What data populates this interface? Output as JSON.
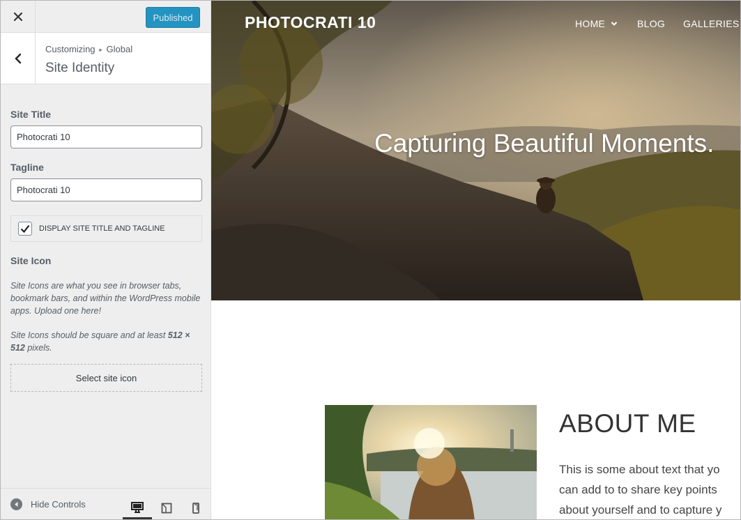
{
  "sidebar": {
    "publish_label": "Published",
    "breadcrumb_root": "Customizing",
    "breadcrumb_child": "Global",
    "section_title": "Site Identity",
    "site_title_label": "Site Title",
    "site_title_value": "Photocrati 10",
    "tagline_label": "Tagline",
    "tagline_value": "Photocrati 10",
    "display_checkbox_label": "Display Site Title and Tagline",
    "display_checkbox_checked": true,
    "site_icon_label": "Site Icon",
    "site_icon_desc": "Site Icons are what you see in browser tabs, bookmark bars, and within the WordPress mobile apps. Upload one here!",
    "site_icon_size_pre": "Site Icons should be square and at least ",
    "site_icon_size_value": "512 × 512",
    "site_icon_size_post": " pixels.",
    "select_icon_label": "Select site icon",
    "hide_controls_label": "Hide Controls"
  },
  "preview": {
    "site_title": "PHOTOCRATI 10",
    "nav": [
      "HOME",
      "BLOG",
      "GALLERIES"
    ],
    "hero_text": "Capturing Beautiful Moments.",
    "about_heading": "ABOUT ME",
    "about_lines": [
      "This is some about text that yo",
      "can add to to share key points",
      "about yourself and to capture y"
    ]
  },
  "colors": {
    "primary_button": "#0085ba",
    "sidebar_bg": "#eeeeee",
    "text": "#555d66"
  }
}
